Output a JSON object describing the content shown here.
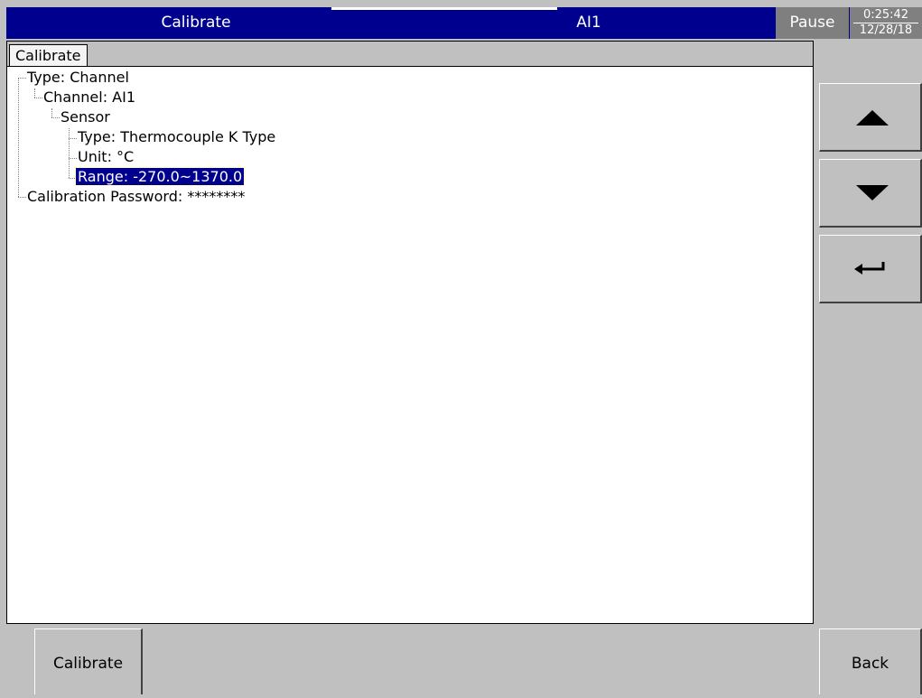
{
  "titlebar": {
    "screen_title": "Calibrate",
    "channel": "AI1",
    "status": "Pause",
    "time": "0:25:42",
    "date": "12/28/18",
    "background_color": "#00008e"
  },
  "tabs": [
    {
      "label": "Calibrate",
      "selected": true
    }
  ],
  "tree": {
    "type": "Type: Channel",
    "channel": "Channel: AI1",
    "sensor": "Sensor",
    "sensor_type": "Type: Thermocouple K Type",
    "unit": "Unit: °C",
    "range": "Range: -270.0~1370.0",
    "password": "Calibration Password: ********",
    "selected_item": "range"
  },
  "side_buttons": {
    "up": "arrow-up-icon",
    "down": "arrow-down-icon",
    "enter": "enter-return-icon"
  },
  "bottom": {
    "calibrate_label": "Calibrate",
    "back_label": "Back"
  },
  "colors": {
    "selection": "#00008e",
    "window_bg": "#c0c0c0"
  }
}
